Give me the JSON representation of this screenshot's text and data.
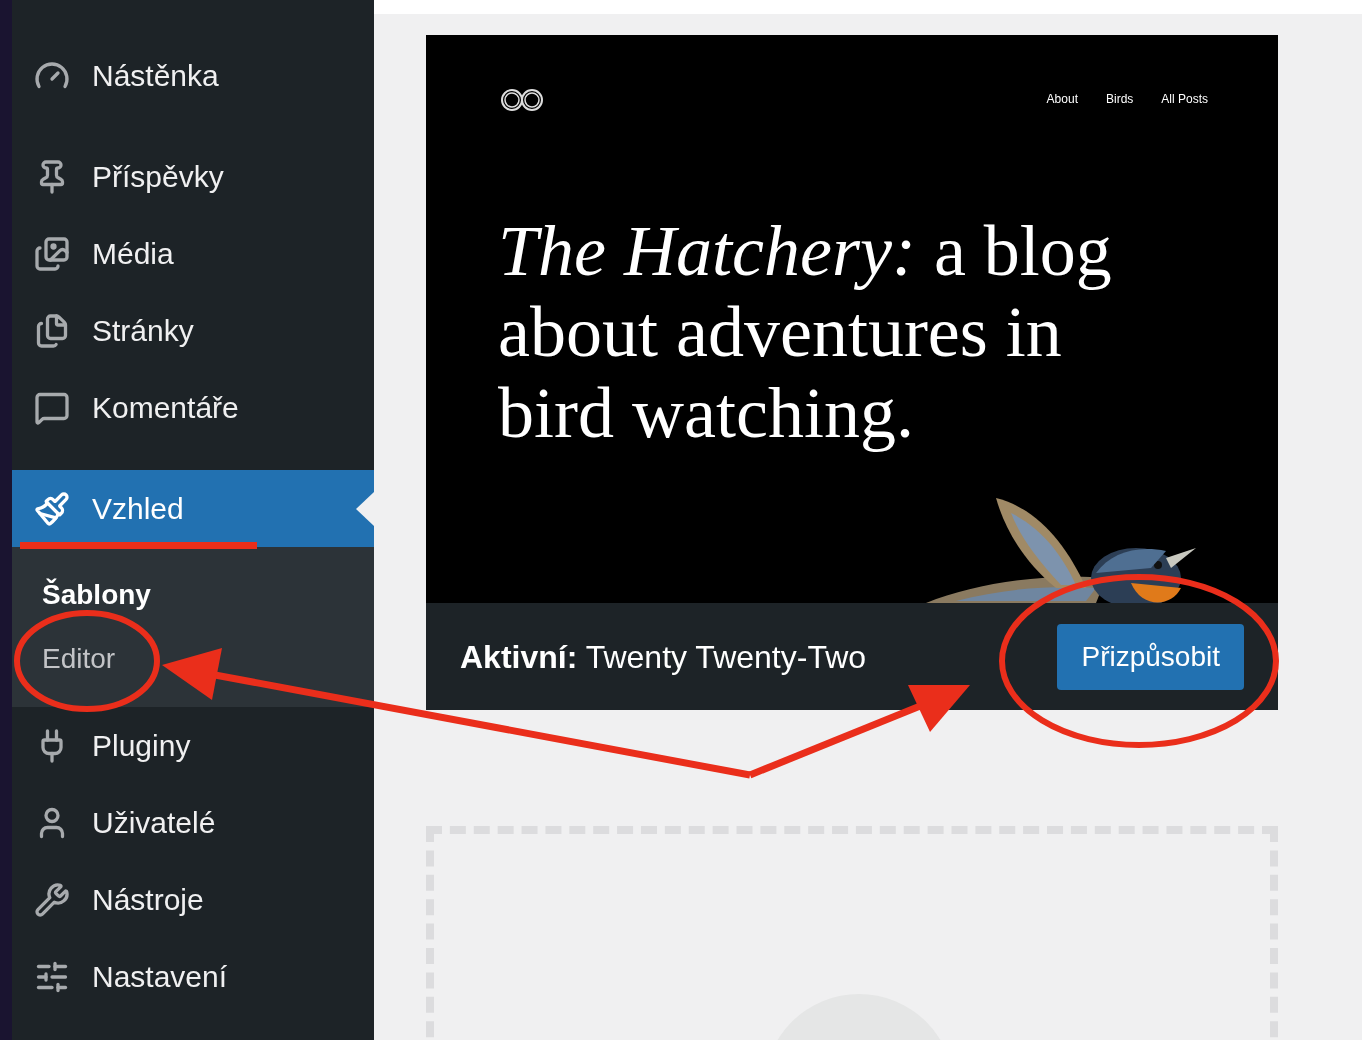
{
  "sidebar": {
    "items": [
      {
        "label": "Nástěnka",
        "selected": false
      },
      {
        "label": "Příspěvky",
        "selected": false
      },
      {
        "label": "Média",
        "selected": false
      },
      {
        "label": "Stránky",
        "selected": false
      },
      {
        "label": "Komentáře",
        "selected": false
      },
      {
        "label": "Vzhled",
        "selected": true,
        "children": [
          {
            "label": "Šablony",
            "selected": true
          },
          {
            "label": "Editor",
            "selected": false
          }
        ]
      },
      {
        "label": "Pluginy",
        "selected": false
      },
      {
        "label": "Uživatelé",
        "selected": false
      },
      {
        "label": "Nástroje",
        "selected": false
      },
      {
        "label": "Nastavení",
        "selected": false
      }
    ]
  },
  "theme_card": {
    "preview": {
      "nav": [
        "About",
        "Birds",
        "All Posts"
      ],
      "headline": "*The Hatchery:* a blog about adventures in bird watching."
    },
    "active_label": "**Aktivní:** Twenty Twenty-Two",
    "button": "Přizpůsobit"
  }
}
